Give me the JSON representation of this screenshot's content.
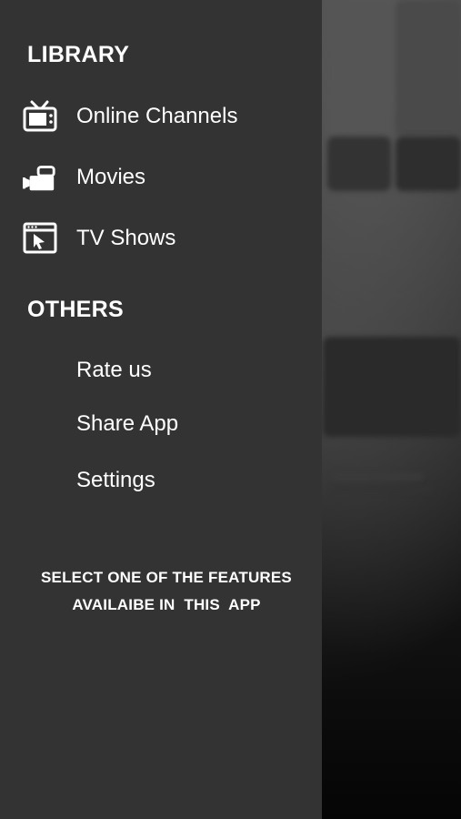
{
  "drawer": {
    "library_title": "LIBRARY",
    "library_items": [
      {
        "label": "Online Channels",
        "icon": "tv-icon"
      },
      {
        "label": "Movies",
        "icon": "video-camera-icon"
      },
      {
        "label": "TV Shows",
        "icon": "browser-window-cursor-icon"
      }
    ],
    "others_title": "OTHERS",
    "others_items": [
      {
        "label": "Rate us"
      },
      {
        "label": "Share App"
      },
      {
        "label": "Settings"
      }
    ],
    "footer_line1": "SELECT ONE OF THE FEATURES",
    "footer_line2": "AVAILAIBE IN  THIS  APP"
  },
  "colors": {
    "drawer_bg": "#333333",
    "text": "#ffffff"
  }
}
